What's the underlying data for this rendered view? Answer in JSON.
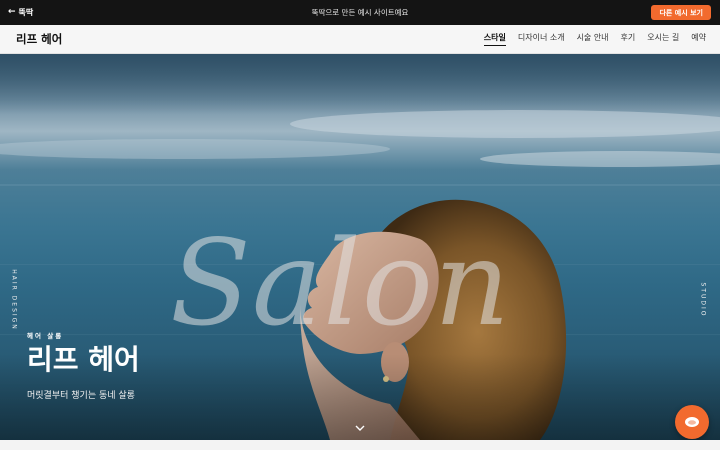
{
  "promo_bar": {
    "back_label": "뚝딱",
    "center_text": "뚝딱으로 만든 예시 사이트예요",
    "cta_label": "다른 예시 보기"
  },
  "header": {
    "logo": "리프 헤어",
    "nav": [
      {
        "label": "스타일",
        "active": true
      },
      {
        "label": "디자이너 소개",
        "active": false
      },
      {
        "label": "시술 안내",
        "active": false
      },
      {
        "label": "후기",
        "active": false
      },
      {
        "label": "오시는 길",
        "active": false
      },
      {
        "label": "예약",
        "active": false
      }
    ]
  },
  "hero": {
    "background_word": "Salon",
    "side_left": "HAIR DESIGN",
    "side_right": "STUDIO",
    "eyebrow": "헤어 살롱",
    "title": "리프 헤어",
    "subtitle": "머릿결부터 챙기는 동네 살롱"
  },
  "colors": {
    "accent": "#f26a2e",
    "promo_bg": "#141414",
    "header_bg": "#f6f6f6"
  },
  "icons": {
    "back": "arrow-left-icon",
    "scroll": "chevron-down-icon",
    "fab": "chat-bubble-icon"
  }
}
